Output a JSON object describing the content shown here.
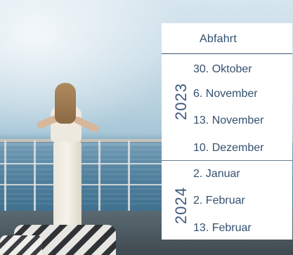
{
  "panel": {
    "header": "Abfahrt",
    "years": [
      {
        "year": "2023",
        "dates": [
          "30. Oktober",
          "6. November",
          "13. November",
          "10. Dezember"
        ]
      },
      {
        "year": "2024",
        "dates": [
          "2. Januar",
          "2. Februar",
          "13. Februar"
        ]
      }
    ]
  },
  "colors": {
    "text": "#34516f",
    "rule": "#3a5573",
    "panel_bg": "#ffffff"
  }
}
